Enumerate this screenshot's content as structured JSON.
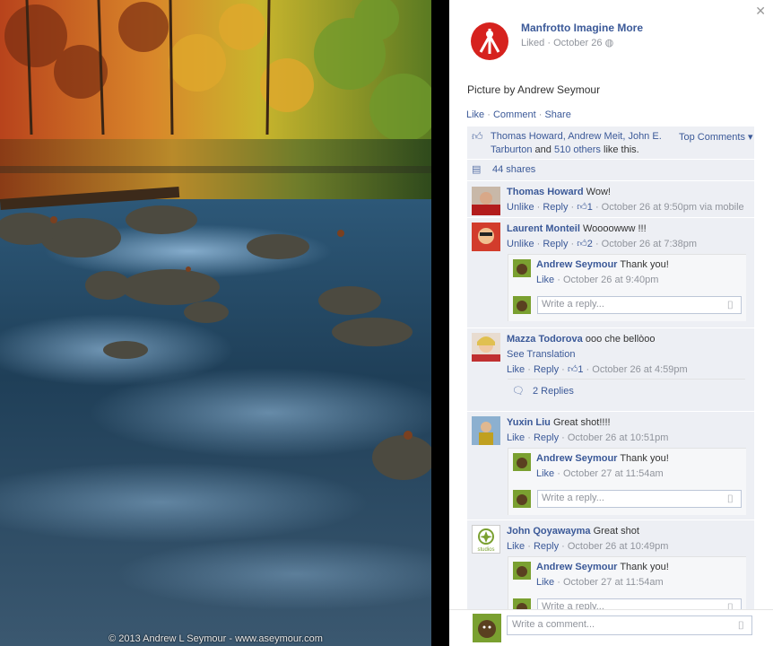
{
  "photo": {
    "credit": "© 2013 Andrew L Seymour - www.aseymour.com"
  },
  "page": {
    "name": "Manfrotto Imagine More",
    "liked": "Liked",
    "date": "October 26",
    "globe_icon": "globe-icon"
  },
  "post": {
    "caption": "Picture by Andrew Seymour"
  },
  "actions": {
    "like": "Like",
    "comment": "Comment",
    "share": "Share"
  },
  "likes": {
    "names": "Thomas Howard, Andrew Meit, John E. Tarburton",
    "and": " and ",
    "others": "510 others",
    "suffix": " like this.",
    "top_comments": "Top Comments ▾"
  },
  "shares": {
    "text": "44 shares"
  },
  "comments": [
    {
      "author": "Thomas Howard",
      "text": "Wow!",
      "action": "Unlike",
      "reply": "Reply",
      "likes": "1",
      "time": "October 26 at 9:50pm via mobile"
    },
    {
      "author": "Laurent Monteil",
      "text": "Woooowww !!!",
      "action": "Unlike",
      "reply": "Reply",
      "likes": "2",
      "time": "October 26 at 7:38pm"
    },
    {
      "author": "Mazza Todorova",
      "text": "ooo che bellòoo",
      "translate": "See Translation",
      "action": "Like",
      "reply": "Reply",
      "likes": "1",
      "time": "October 26 at 4:59pm",
      "replies_link": "2 Replies"
    },
    {
      "author": "Yuxin Liu",
      "text": "Great shot!!!!",
      "action": "Like",
      "reply": "Reply",
      "time": "October 26 at 10:51pm"
    },
    {
      "author": "John Qoyawayma",
      "text": "Great shot",
      "action": "Like",
      "reply": "Reply",
      "time": "October 26 at 10:49pm"
    }
  ],
  "replies": [
    {
      "author": "Andrew Seymour",
      "text": "Thank you!",
      "action": "Like",
      "time": "October 26 at 9:40pm"
    },
    {
      "author": "Andrew Seymour",
      "text": "Thank you!",
      "action": "Like",
      "time": "October 27 at 11:54am"
    },
    {
      "author": "Andrew Seymour",
      "text": "Thank you!",
      "action": "Like",
      "time": "October 27 at 11:54am"
    }
  ],
  "reply_placeholder": "Write a reply...",
  "comment_placeholder": "Write a comment...",
  "studios_logo_text": "studios",
  "colors": {
    "link": "#3b5998",
    "meta": "#90949c",
    "ufi_bg": "#edeff4",
    "brand_red": "#d6221e"
  }
}
